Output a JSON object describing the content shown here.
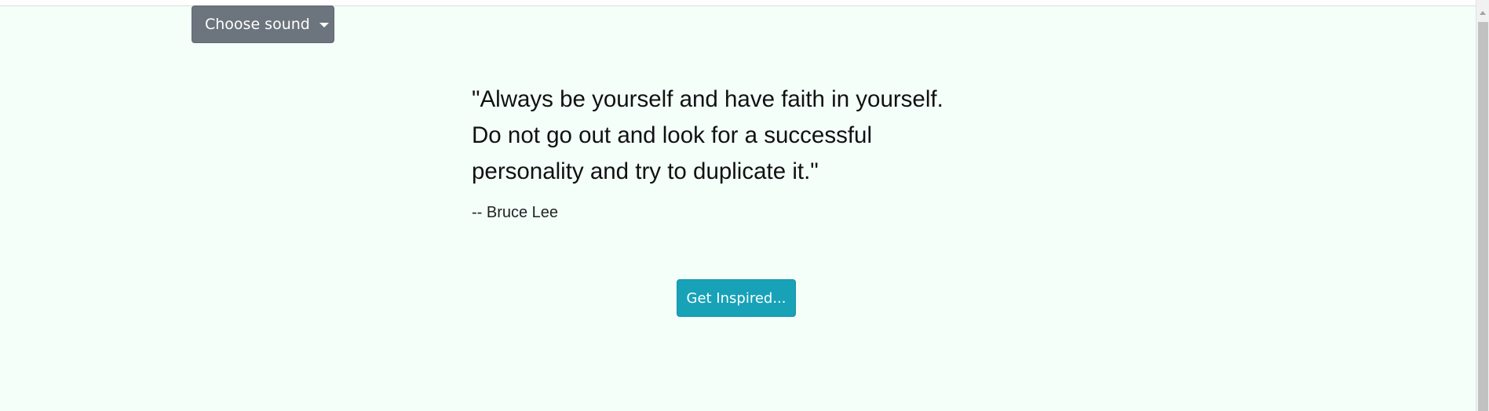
{
  "sound_menu": {
    "label": "Choose sound",
    "icon": "caret-down-icon"
  },
  "quote": {
    "lines": [
      "\"Always be yourself and have faith in yourself.",
      "Do not go out and look for a successful",
      "personality and try to duplicate it.\""
    ],
    "author": "-- Bruce Lee"
  },
  "inspire_button": {
    "label": "Get Inspired..."
  },
  "colors": {
    "background": "#f4fffa",
    "dropdown": "#6c757d",
    "button": "#17a2b8"
  }
}
